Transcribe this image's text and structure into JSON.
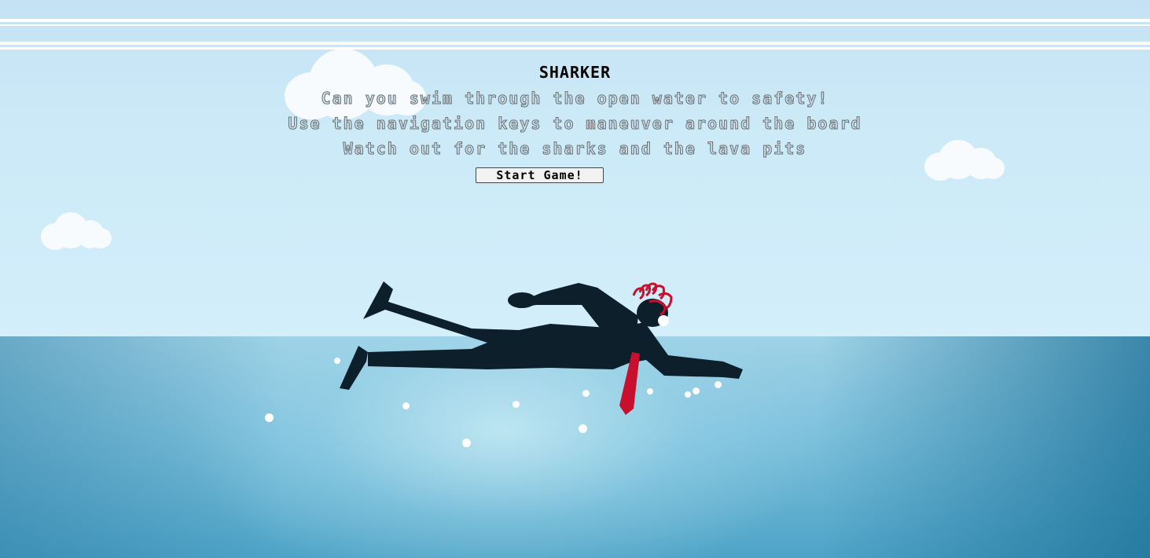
{
  "game": {
    "title": "SHARKER",
    "instructions": [
      "Can you swim through the open water to safety!",
      "Use the navigation keys to maneuver around the board",
      "Watch out for the sharks and the lava pits"
    ],
    "start_button_label": "Start Game!"
  },
  "scene": {
    "sky_color": "#cbe9f7",
    "sea_color": "#7cc0dc",
    "swimmer_color": "#0d1f2a",
    "hair_color": "#c8102e",
    "tie_color": "#c8102e"
  }
}
